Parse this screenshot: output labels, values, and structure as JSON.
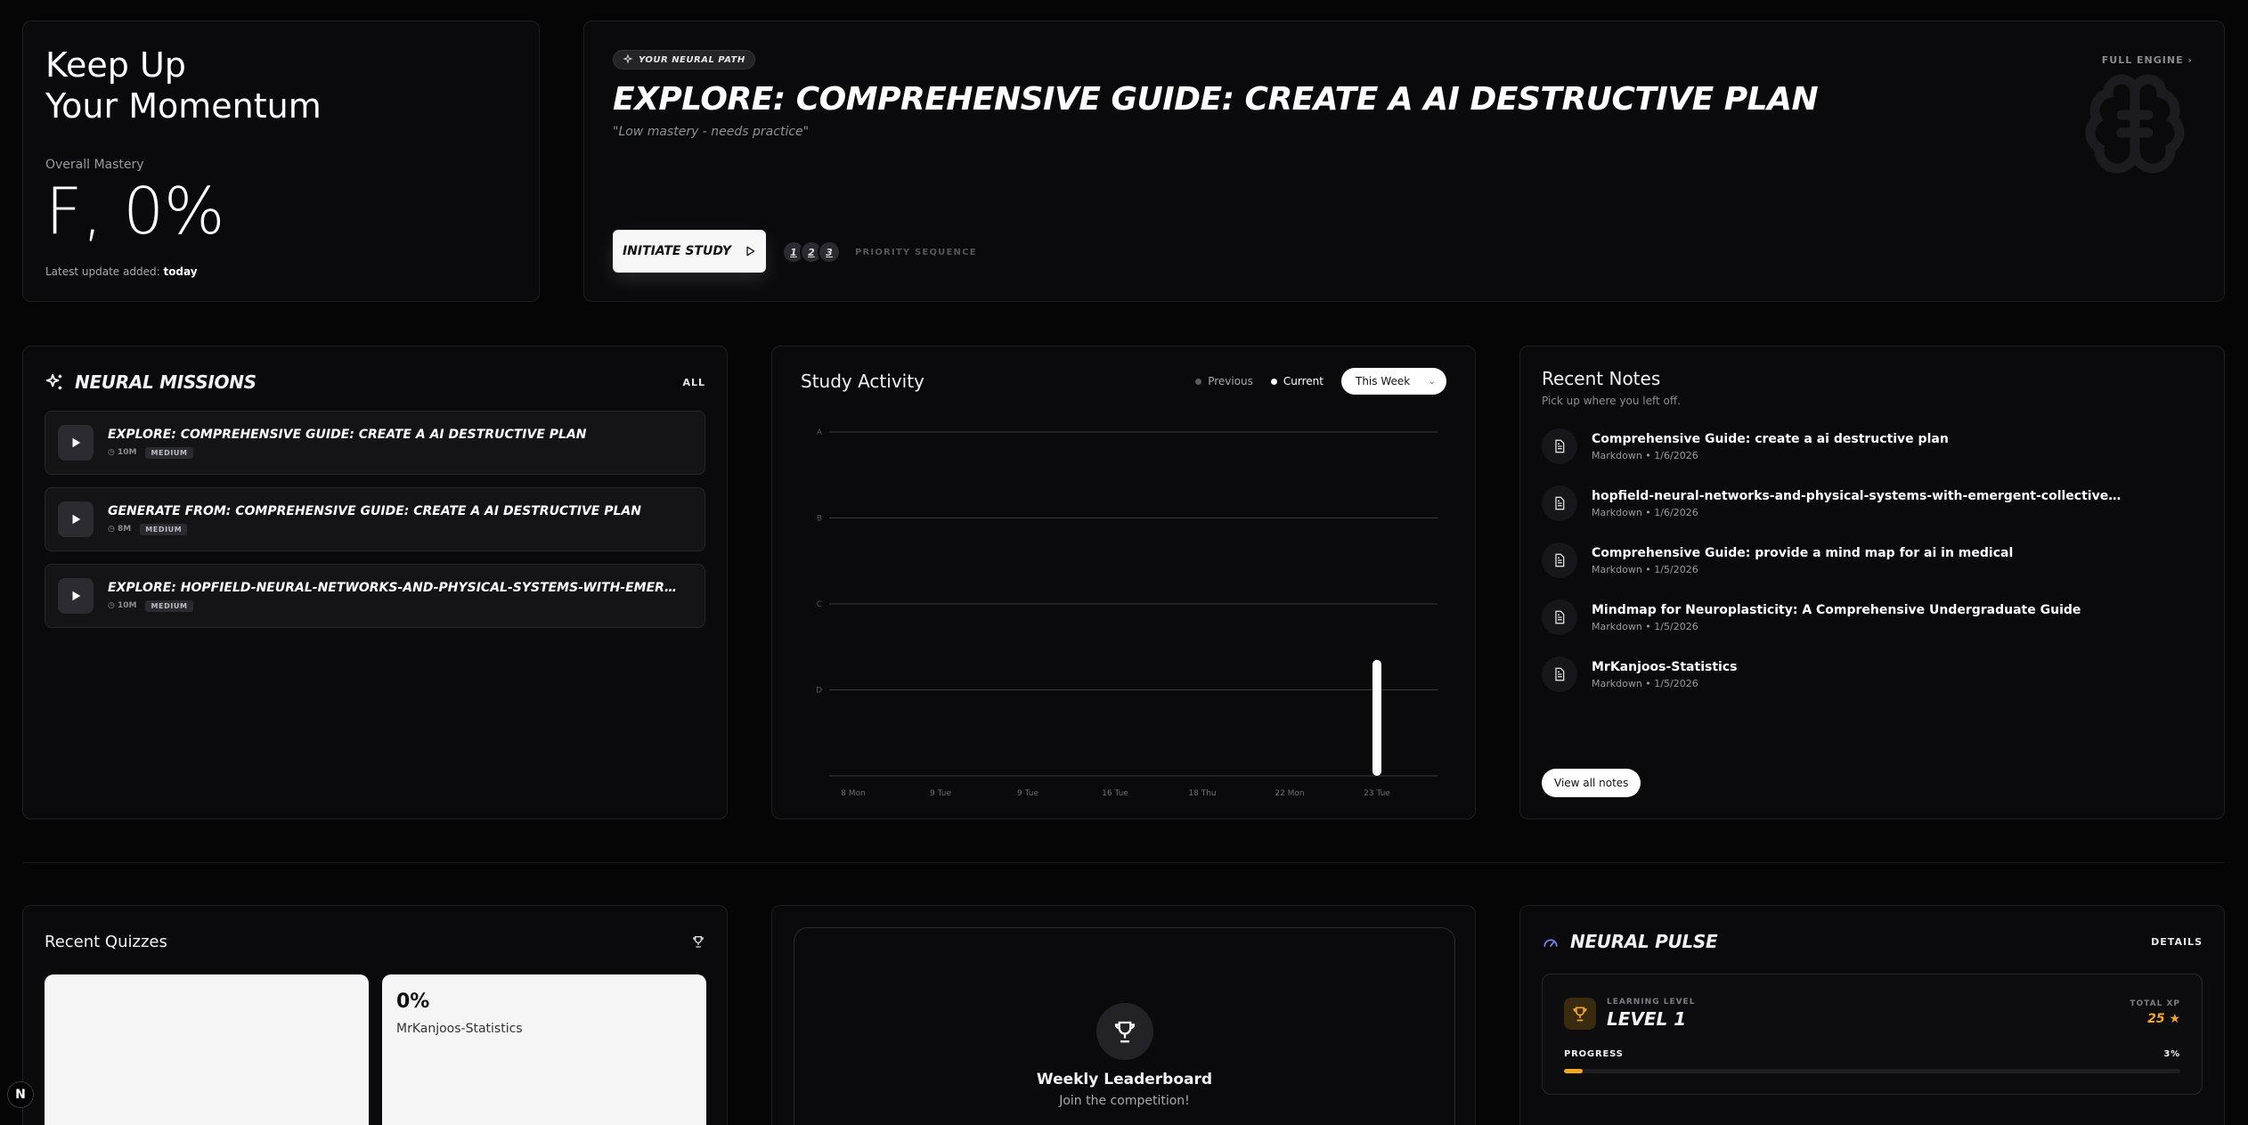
{
  "hero": {
    "title_line1": "Keep Up",
    "title_line2": "Your Momentum",
    "mastery_label": "Overall Mastery",
    "mastery_value": "F, 0%",
    "update_prefix": "Latest update added:",
    "update_value": "today"
  },
  "neural_path": {
    "tag": "YOUR NEURAL PATH",
    "title": "EXPLORE: COMPREHENSIVE GUIDE: CREATE A AI DESTRUCTIVE PLAN",
    "quote": "\"Low mastery - needs practice\"",
    "full_engine": "FULL ENGINE",
    "initiate_label": "INITIATE STUDY",
    "sequence": [
      "1",
      "2",
      "3"
    ],
    "sequence_label": "PRIORITY SEQUENCE"
  },
  "missions": {
    "title": "NEURAL MISSIONS",
    "all_label": "ALL",
    "items": [
      {
        "title": "EXPLORE: COMPREHENSIVE GUIDE: CREATE A AI DESTRUCTIVE PLAN",
        "duration": "10M",
        "level": "MEDIUM"
      },
      {
        "title": "GENERATE FROM: COMPREHENSIVE GUIDE: CREATE A AI DESTRUCTIVE PLAN",
        "duration": "8M",
        "level": "MEDIUM"
      },
      {
        "title": "EXPLORE: HOPFIELD-NEURAL-NETWORKS-AND-PHYSICAL-SYSTEMS-WITH-EMERGENT-COLLECTIVE-COMPUTATIONAL-ABILITIES",
        "duration": "10M",
        "level": "MEDIUM"
      }
    ]
  },
  "activity": {
    "title": "Study Activity",
    "legend_previous": "Previous",
    "legend_current": "Current",
    "range_label": "This Week"
  },
  "chart_data": {
    "type": "bar",
    "categories": [
      "8 Mon",
      "9 Tue",
      "9 Tue",
      "16 Tue",
      "18 Thu",
      "22 Mon",
      "23 Tue"
    ],
    "y_ticks": [
      "A",
      "B",
      "C",
      "D"
    ],
    "series": [
      {
        "name": "Previous",
        "values": [
          0,
          0,
          0,
          0,
          0,
          0,
          0
        ]
      },
      {
        "name": "Current",
        "values": [
          0,
          0,
          0,
          0,
          0,
          0,
          1.35
        ]
      }
    ],
    "ylim": [
      0,
      4
    ],
    "grid": true,
    "colors": {
      "current": "#ffffff",
      "previous": "#5a5a60",
      "grid": "#3a3a40"
    }
  },
  "notes": {
    "title": "Recent Notes",
    "subtitle": "Pick up where you left off.",
    "items": [
      {
        "title": "Comprehensive Guide: create a ai destructive plan",
        "meta": "Markdown • 1/6/2026"
      },
      {
        "title": "hopfield-neural-networks-and-physical-systems-with-emergent-collective-computational-abilities",
        "meta": "Markdown • 1/6/2026"
      },
      {
        "title": "Comprehensive Guide: provide a mind map for ai in medical",
        "meta": "Markdown • 1/5/2026"
      },
      {
        "title": "Mindmap for Neuroplasticity: A Comprehensive Undergraduate Guide",
        "meta": "Markdown • 1/5/2026"
      },
      {
        "title": "MrKanjoos-Statistics",
        "meta": "Markdown • 1/5/2026"
      }
    ],
    "view_all": "View all notes"
  },
  "quizzes": {
    "title": "Recent Quizzes",
    "items": [
      {
        "score": "",
        "name": ""
      },
      {
        "score": "0%",
        "name": "MrKanjoos-Statistics"
      }
    ]
  },
  "leaderboard": {
    "title": "Weekly Leaderboard",
    "subtitle": "Join the competition!"
  },
  "pulse": {
    "title": "NEURAL PULSE",
    "details": "DETAILS",
    "level_label": "LEARNING LEVEL",
    "level_value": "LEVEL 1",
    "xp_label": "TOTAL XP",
    "xp_value": "25",
    "progress_label": "PROGRESS",
    "progress_value": "3%",
    "progress_fraction": 0.03,
    "accent": "#f5a623"
  },
  "next_badge": "N"
}
